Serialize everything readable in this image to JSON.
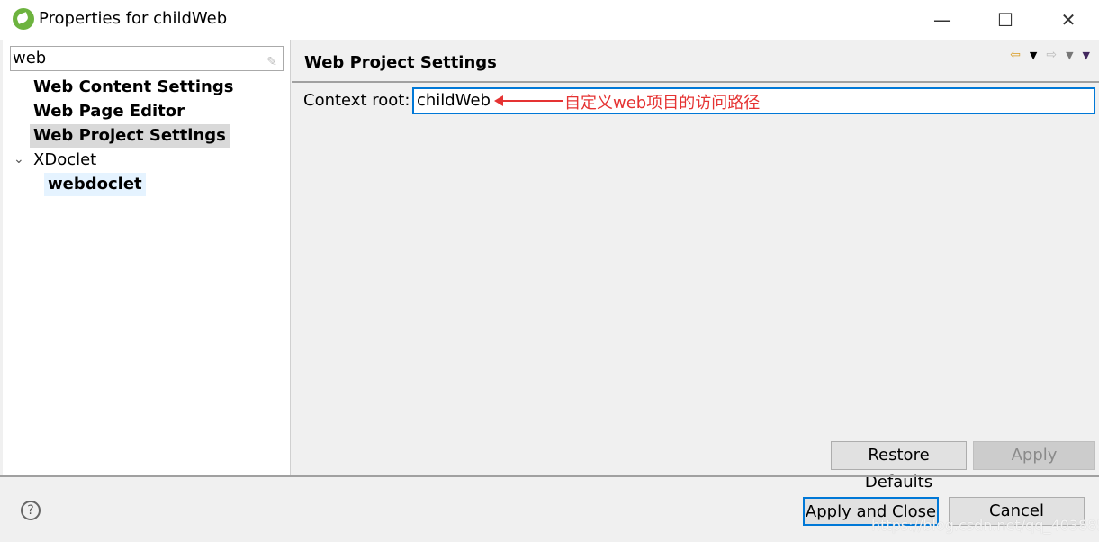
{
  "window": {
    "title": "Properties for childWeb",
    "minimize": "—",
    "maximize": "☐",
    "close": "✕"
  },
  "sidebar": {
    "filter_value": "web",
    "clear_icon": "✎",
    "items": [
      {
        "label": "Web Content Settings"
      },
      {
        "label": "Web Page Editor"
      },
      {
        "label": "Web Project Settings",
        "selected": true
      },
      {
        "label": "XDoclet",
        "expanded": true
      },
      {
        "label": "webdoclet"
      }
    ],
    "expand_icon": "⌄"
  },
  "page": {
    "title": "Web Project Settings",
    "context_label": "Context root:",
    "context_value": "childWeb",
    "annotation": "自定义web项目的访问路径",
    "nav": {
      "back": "⇦",
      "back_menu": "▼",
      "forward": "⇨",
      "forward_menu": "▼",
      "view_menu": "▼"
    },
    "restore_defaults": "Restore Defaults",
    "apply": "Apply"
  },
  "footer": {
    "help": "?",
    "apply_close": "Apply and Close",
    "cancel": "Cancel"
  },
  "watermark": "https://blog.csdn.net/qq_40388552",
  "colors": {
    "accent": "#0078d7",
    "annotation": "#e53333"
  }
}
